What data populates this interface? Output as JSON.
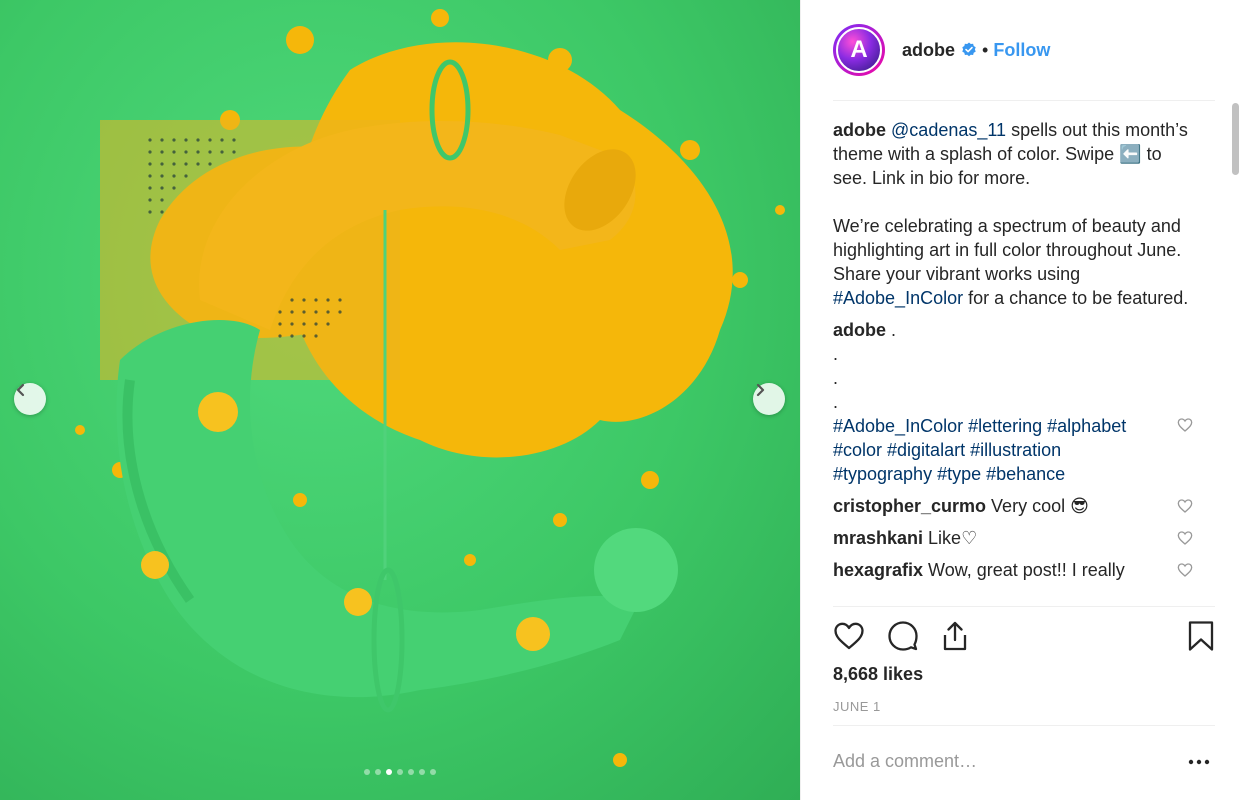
{
  "post": {
    "username": "adobe",
    "separator": "•",
    "follow_label": "Follow",
    "avatar_letter": "A",
    "media": {
      "slide_count": 7,
      "active_slide": 3
    }
  },
  "caption": {
    "author": "adobe",
    "mention": "@cadenas_11",
    "line1_rest": " spells out this month’s theme with a splash of color. Swipe ",
    "swipe_emoji": "⬅️",
    "line1_end": " to see. Link in bio for more.",
    "para2_start": "We’re celebrating a spectrum of beauty and highlighting art in full color throughout June. Share your vibrant works using ",
    "para2_tag": "#Adobe_InColor",
    "para2_end": " for a chance to be featured."
  },
  "comments": [
    {
      "user": "adobe",
      "text": " .",
      "extra_lines": [
        ".",
        ".",
        "."
      ],
      "tags": "#Adobe_InColor #lettering #alphabet #color #digitalart #illustration #typography #type #behance"
    },
    {
      "user": "cristopher_curmo",
      "text": " Very cool 😎"
    },
    {
      "user": "mrashkani",
      "text": " Like♡"
    },
    {
      "user": "hexagrafix",
      "text": " Wow, great post!! I really"
    }
  ],
  "stats": {
    "likes": "8,668 likes",
    "date": "JUNE 1"
  },
  "composer": {
    "placeholder": "Add a comment…",
    "more": "•••"
  },
  "colors": {
    "accent": "#3897f0",
    "link": "#003569",
    "media_green": "#3dc866",
    "media_yellow": "#f5b70a"
  }
}
